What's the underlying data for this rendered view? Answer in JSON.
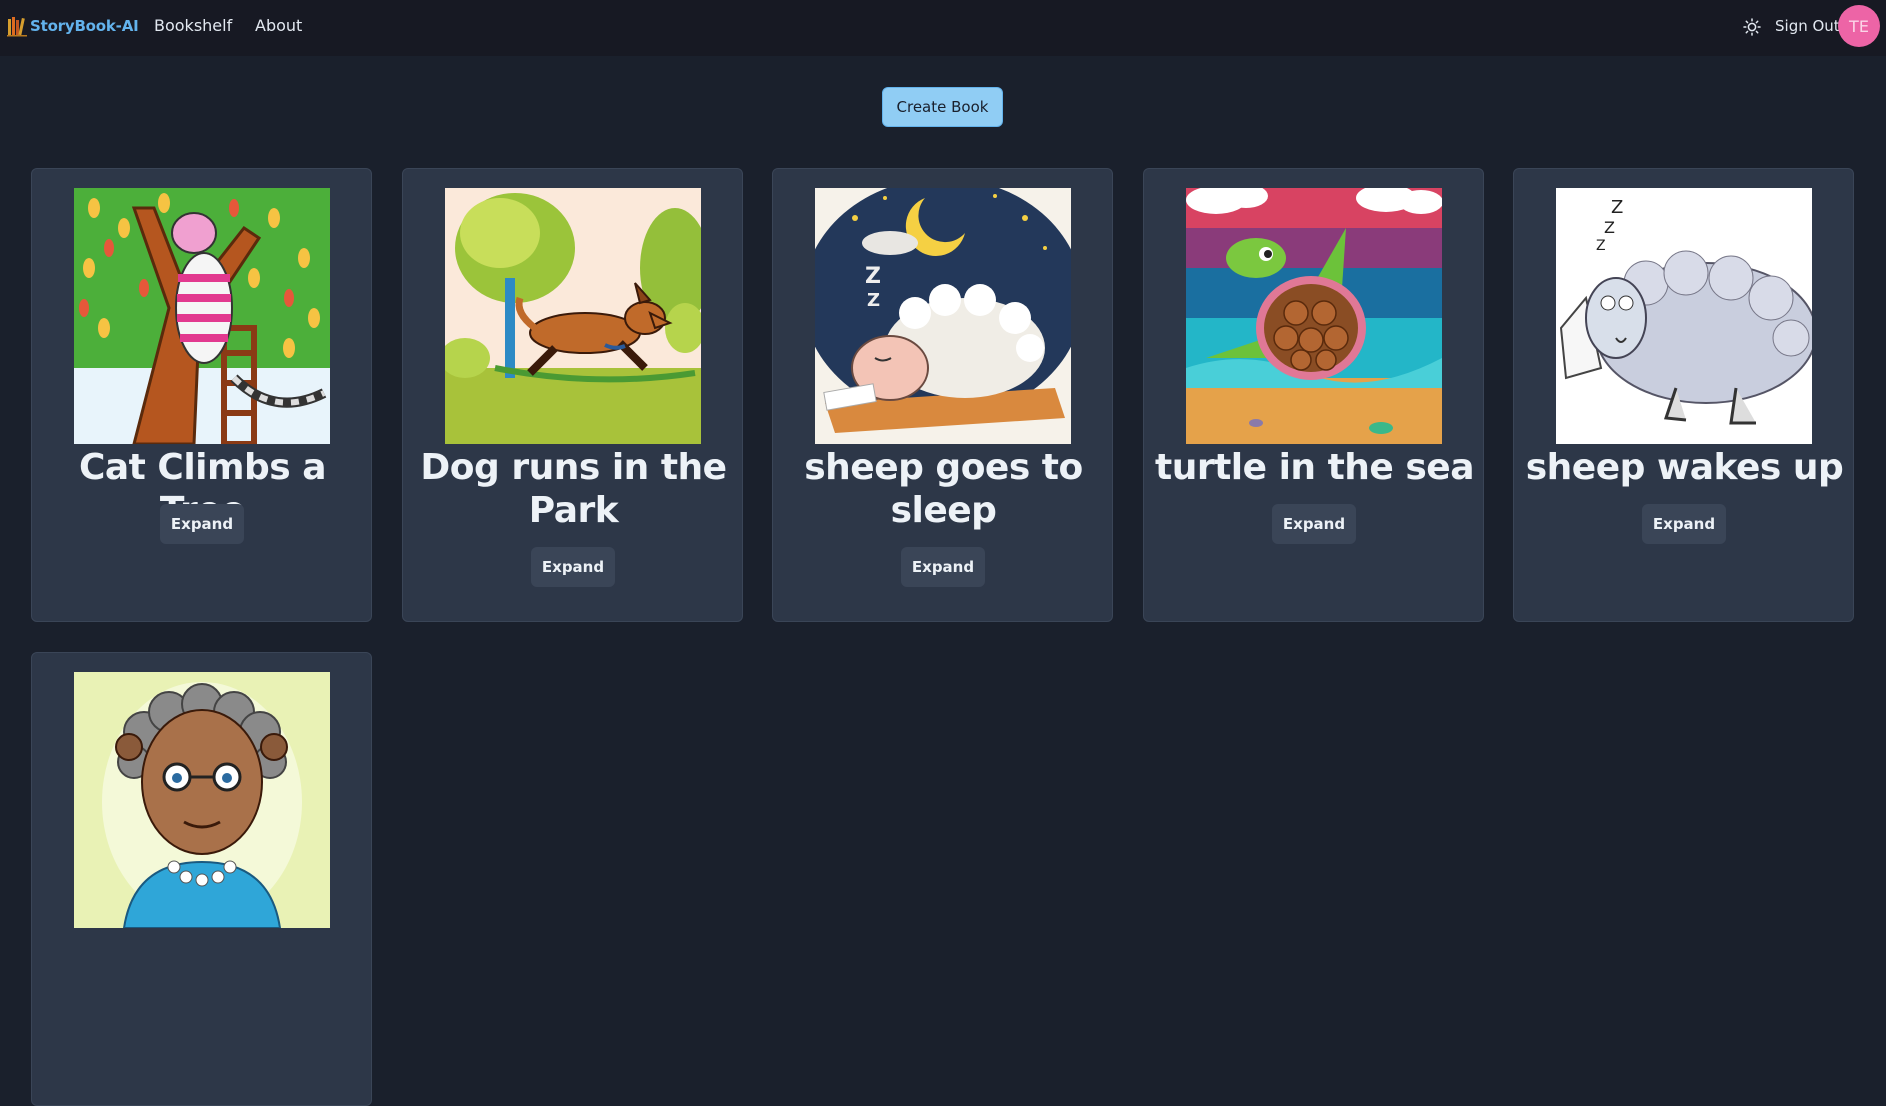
{
  "navbar": {
    "brand": "StoryBook-AI",
    "links": [
      "Bookshelf",
      "About"
    ],
    "theme_icon": "sun-icon",
    "sign_out": "Sign Out",
    "avatar_initials": "TE"
  },
  "main": {
    "create_button": "Create Book",
    "books": [
      {
        "title": "Cat Climbs a Tree",
        "expand": "Expand",
        "image": "cat-in-tree-illustration"
      },
      {
        "title": "Dog runs in the Park",
        "expand": "Expand",
        "image": "dog-running-illustration"
      },
      {
        "title": "sheep goes to sleep",
        "expand": "Expand",
        "image": "sleeping-sheep-moon-illustration"
      },
      {
        "title": "turtle in the sea",
        "expand": "Expand",
        "image": "sea-turtle-illustration"
      },
      {
        "title": "sheep wakes up",
        "expand": "Expand",
        "image": "sheep-in-bed-illustration"
      },
      {
        "title": "",
        "expand": "",
        "image": "grandmother-portrait-illustration"
      }
    ]
  },
  "colors": {
    "background": "#1a202c",
    "navbar": "#171923",
    "card": "#2d3748",
    "accent": "#90cdf4",
    "brand": "#63b3ed",
    "avatar": "#ed64a6"
  }
}
